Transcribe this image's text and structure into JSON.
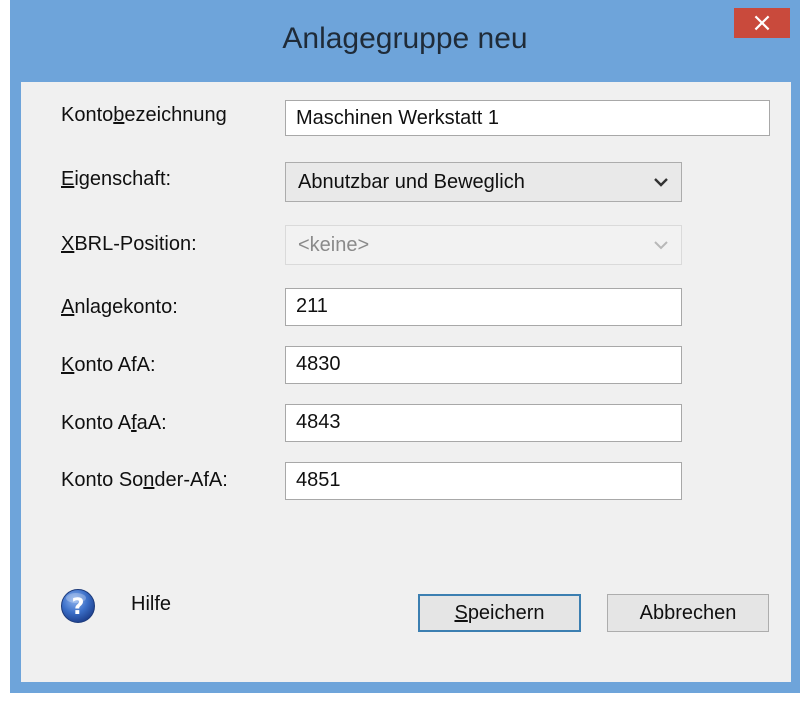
{
  "dialog": {
    "title": "Anlagegruppe neu",
    "close_label": "×"
  },
  "form": {
    "kontobezeichnung": {
      "label_pre": "Konto",
      "label_key": "b",
      "label_post": "ezeichnung",
      "value": "Maschinen Werkstatt 1"
    },
    "eigenschaft": {
      "label_pre": "",
      "label_key": "E",
      "label_post": "igenschaft:",
      "value": "Abnutzbar und Beweglich"
    },
    "xbrl": {
      "label_pre": "",
      "label_key": "X",
      "label_post": "BRL-Position:",
      "value": "<keine>"
    },
    "anlagekonto": {
      "label_pre": "",
      "label_key": "A",
      "label_post": "nlagekonto:",
      "value": "211"
    },
    "konto_afa": {
      "label_pre": "",
      "label_key": "K",
      "label_post": "onto AfA:",
      "value": "4830"
    },
    "konto_afaa": {
      "label_pre": "Konto A",
      "label_key": "f",
      "label_post": "aA:",
      "value": "4843"
    },
    "konto_sonder": {
      "label_pre": "Konto So",
      "label_key": "n",
      "label_post": "der-AfA:",
      "value": "4851"
    }
  },
  "help": {
    "label": "Hilfe",
    "icon": "help-icon"
  },
  "buttons": {
    "save": {
      "pre": "",
      "key": "S",
      "post": "peichern"
    },
    "cancel": {
      "label": "Abbrechen"
    }
  },
  "colors": {
    "frame": "#6ea4da",
    "close": "#c94a3c",
    "client": "#f0f0f0",
    "default_button_border": "#3c7fb1"
  }
}
